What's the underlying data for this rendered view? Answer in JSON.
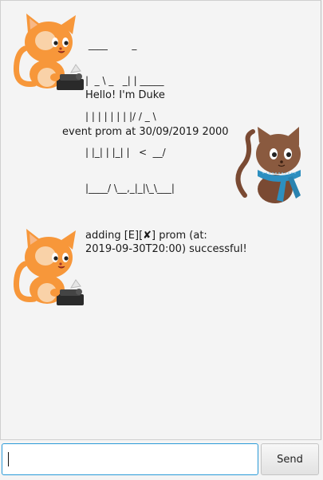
{
  "messages": {
    "greeting": {
      "logo_lines": [
        " ____        _        ",
        "|  _ \\ _   _| | _____ ",
        "| | | | | | | |/ / _ \\",
        "| |_| | |_| |   <  __/",
        "|____/ \\__,_|_|\\_\\___|"
      ],
      "text": "Hello! I'm Duke"
    },
    "user_command": {
      "text": "event prom at 30/09/2019 2000"
    },
    "reply": {
      "text": "adding [E][✘] prom (at:\n2019-09-30T20:00) successful!"
    }
  },
  "input": {
    "value": "",
    "placeholder": ""
  },
  "send_button": {
    "label": "Send"
  },
  "icons": {
    "duke_avatar": "orange-cat-typewriter-icon",
    "user_avatar": "brown-cat-scarf-icon"
  },
  "colors": {
    "orange_cat": "#f7973a",
    "brown_cat": "#7a4a33",
    "scarf": "#2d8fc0",
    "input_focus": "#2a9ad8"
  }
}
